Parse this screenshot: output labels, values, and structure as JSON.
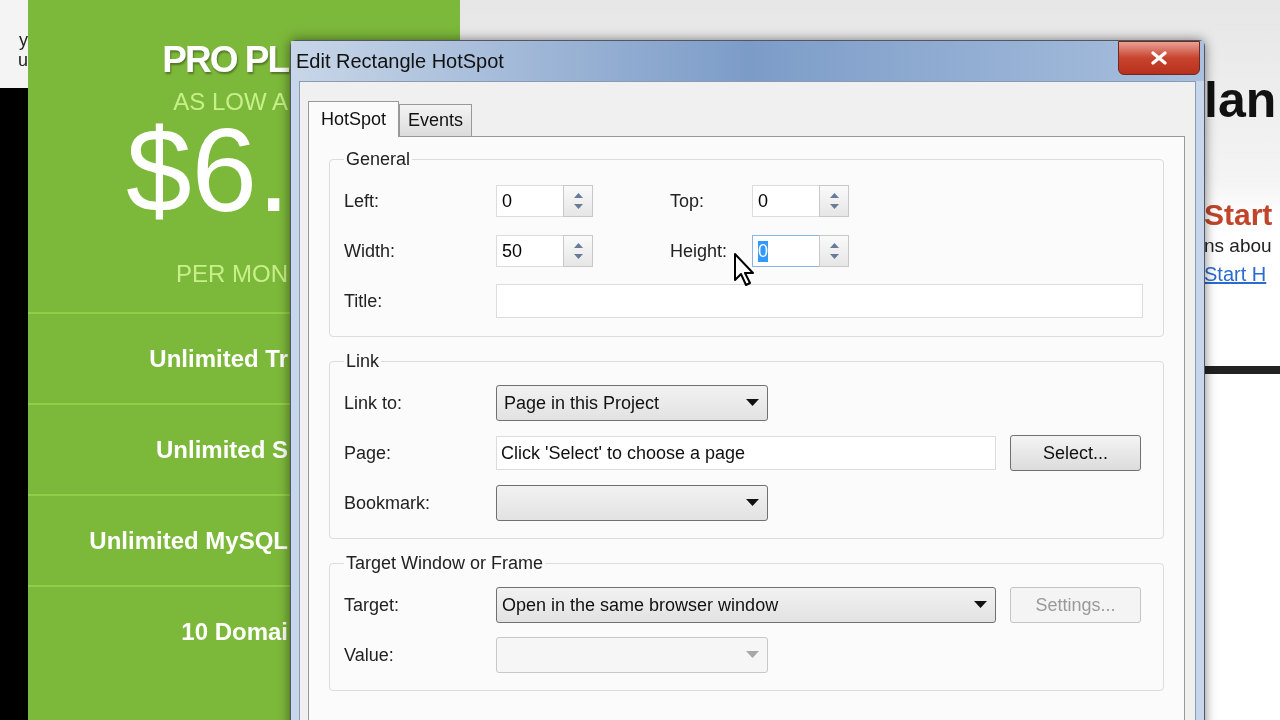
{
  "background_page": {
    "header_fragments": [
      "y",
      "u"
    ],
    "plan": {
      "title": "PRO PL",
      "subtitle": "AS LOW A",
      "price": "$6.",
      "period": "PER MON",
      "features": [
        "Unlimited Tr",
        "Unlimited S",
        "Unlimited MySQL",
        "10 Domai"
      ]
    },
    "side": {
      "heading": "lan",
      "subheading": "Start",
      "text": "ns abou",
      "link": "Start H"
    }
  },
  "window": {
    "title": "Edit Rectangle HotSpot"
  },
  "tabs": [
    {
      "label": "HotSpot",
      "selected": true
    },
    {
      "label": "Events",
      "selected": false
    }
  ],
  "groups": [
    {
      "title": "General",
      "rows": [
        {
          "kind": "spin_pair",
          "fields": [
            {
              "label": "Left:",
              "value": "0",
              "focused": false
            },
            {
              "label": "Top:",
              "value": "0",
              "focused": false
            }
          ]
        },
        {
          "kind": "spin_pair",
          "fields": [
            {
              "label": "Width:",
              "value": "50",
              "focused": false
            },
            {
              "label": "Height:",
              "value": "0",
              "focused": true
            }
          ]
        },
        {
          "kind": "text",
          "label": "Title:"
        }
      ]
    },
    {
      "title": "Link",
      "rows": [
        {
          "kind": "dropdown",
          "label": "Link to:",
          "value": "Page in this Project",
          "disabled": false
        },
        {
          "kind": "text_button",
          "label": "Page:",
          "value": "Click 'Select' to choose a page",
          "button": {
            "label": "Select...",
            "disabled": false
          }
        },
        {
          "kind": "dropdown",
          "label": "Bookmark:",
          "disabled": false
        }
      ]
    },
    {
      "title": "Target Window or Frame",
      "rows": [
        {
          "kind": "dropdown_button",
          "label": "Target:",
          "value": "Open in the same browser window",
          "disabled": false,
          "button": {
            "label": "Settings...",
            "disabled": true
          }
        },
        {
          "kind": "dropdown",
          "label": "Value:",
          "disabled": true
        }
      ]
    }
  ]
}
